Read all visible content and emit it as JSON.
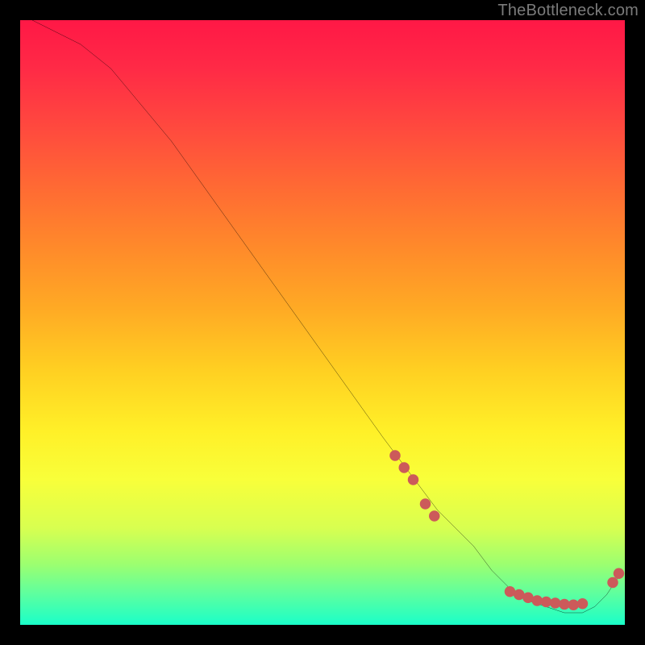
{
  "watermark": "TheBottleneck.com",
  "chart_data": {
    "type": "line",
    "title": "",
    "xlabel": "",
    "ylabel": "",
    "xlim": [
      0,
      100
    ],
    "ylim": [
      0,
      100
    ],
    "background": "rainbow-gradient",
    "series": [
      {
        "name": "bottleneck-curve",
        "color": "#000000",
        "x": [
          2,
          6,
          10,
          15,
          20,
          25,
          30,
          35,
          40,
          45,
          50,
          55,
          60,
          63,
          66,
          69,
          72,
          75,
          78,
          81,
          84,
          87,
          90,
          93,
          95,
          97,
          99
        ],
        "values": [
          100,
          98,
          96,
          92,
          86,
          80,
          73,
          66,
          59,
          52,
          45,
          38,
          31,
          27,
          23,
          19,
          16,
          13,
          9,
          6,
          4,
          3,
          2,
          2,
          3,
          5,
          8
        ]
      }
    ],
    "markers": {
      "name": "highlight-dots",
      "color": "#cc5a5a",
      "radius": 6,
      "points": [
        {
          "x": 62,
          "y": 28
        },
        {
          "x": 63.5,
          "y": 26
        },
        {
          "x": 65,
          "y": 24
        },
        {
          "x": 67,
          "y": 20
        },
        {
          "x": 68.5,
          "y": 18
        },
        {
          "x": 81,
          "y": 5.5
        },
        {
          "x": 82.5,
          "y": 5
        },
        {
          "x": 84,
          "y": 4.5
        },
        {
          "x": 85.5,
          "y": 4
        },
        {
          "x": 87,
          "y": 3.8
        },
        {
          "x": 88.5,
          "y": 3.6
        },
        {
          "x": 90,
          "y": 3.4
        },
        {
          "x": 91.5,
          "y": 3.3
        },
        {
          "x": 93,
          "y": 3.5
        },
        {
          "x": 98,
          "y": 7
        },
        {
          "x": 99,
          "y": 8.5
        }
      ]
    }
  }
}
